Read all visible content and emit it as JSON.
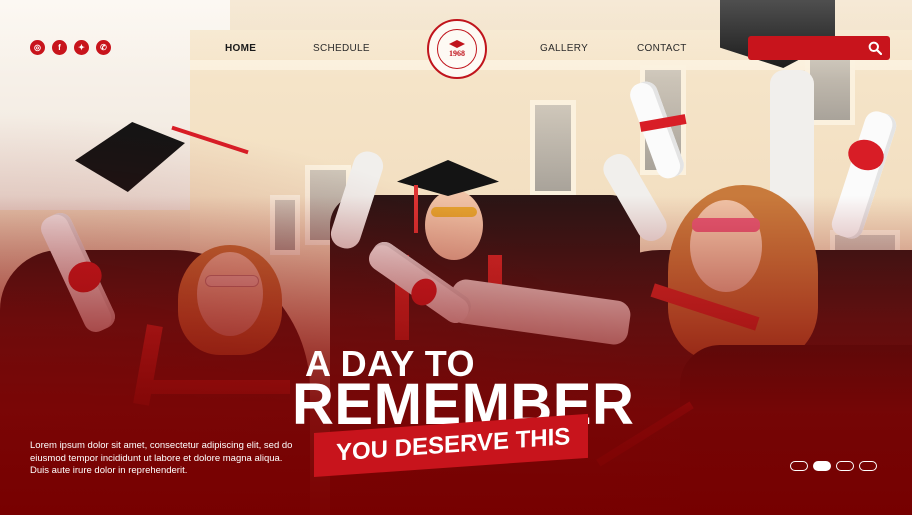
{
  "social": [
    {
      "icon": "instagram-icon",
      "glyph": "◎"
    },
    {
      "icon": "facebook-icon",
      "glyph": "f"
    },
    {
      "icon": "twitter-icon",
      "glyph": "✦"
    },
    {
      "icon": "whatsapp-icon",
      "glyph": "✆"
    }
  ],
  "nav": {
    "home": "HOME",
    "schedule": "SCHEDULE",
    "gallery": "GALLERY",
    "contact": "CONTACT"
  },
  "logo": {
    "year": "1968",
    "ring_text": "INTERNATIONAL COLLEGE GRADUATION UNIVERSITY"
  },
  "search": {
    "placeholder": "",
    "value": ""
  },
  "hero": {
    "line1": "A DAY TO",
    "line2": "REMEMBER",
    "tagline": "YOU DESERVE THIS",
    "description": "Lorem ipsum dolor sit amet, consectetur adipiscing elit, sed do eiusmod tempor incididunt ut labore et dolore magna aliqua. Duis aute irure dolor in reprehenderit."
  },
  "carousel": {
    "count": 4,
    "active_index": 1
  },
  "colors": {
    "accent": "#c8141c",
    "dark_overlay": "#7a0000",
    "text_light": "#ffffff"
  }
}
